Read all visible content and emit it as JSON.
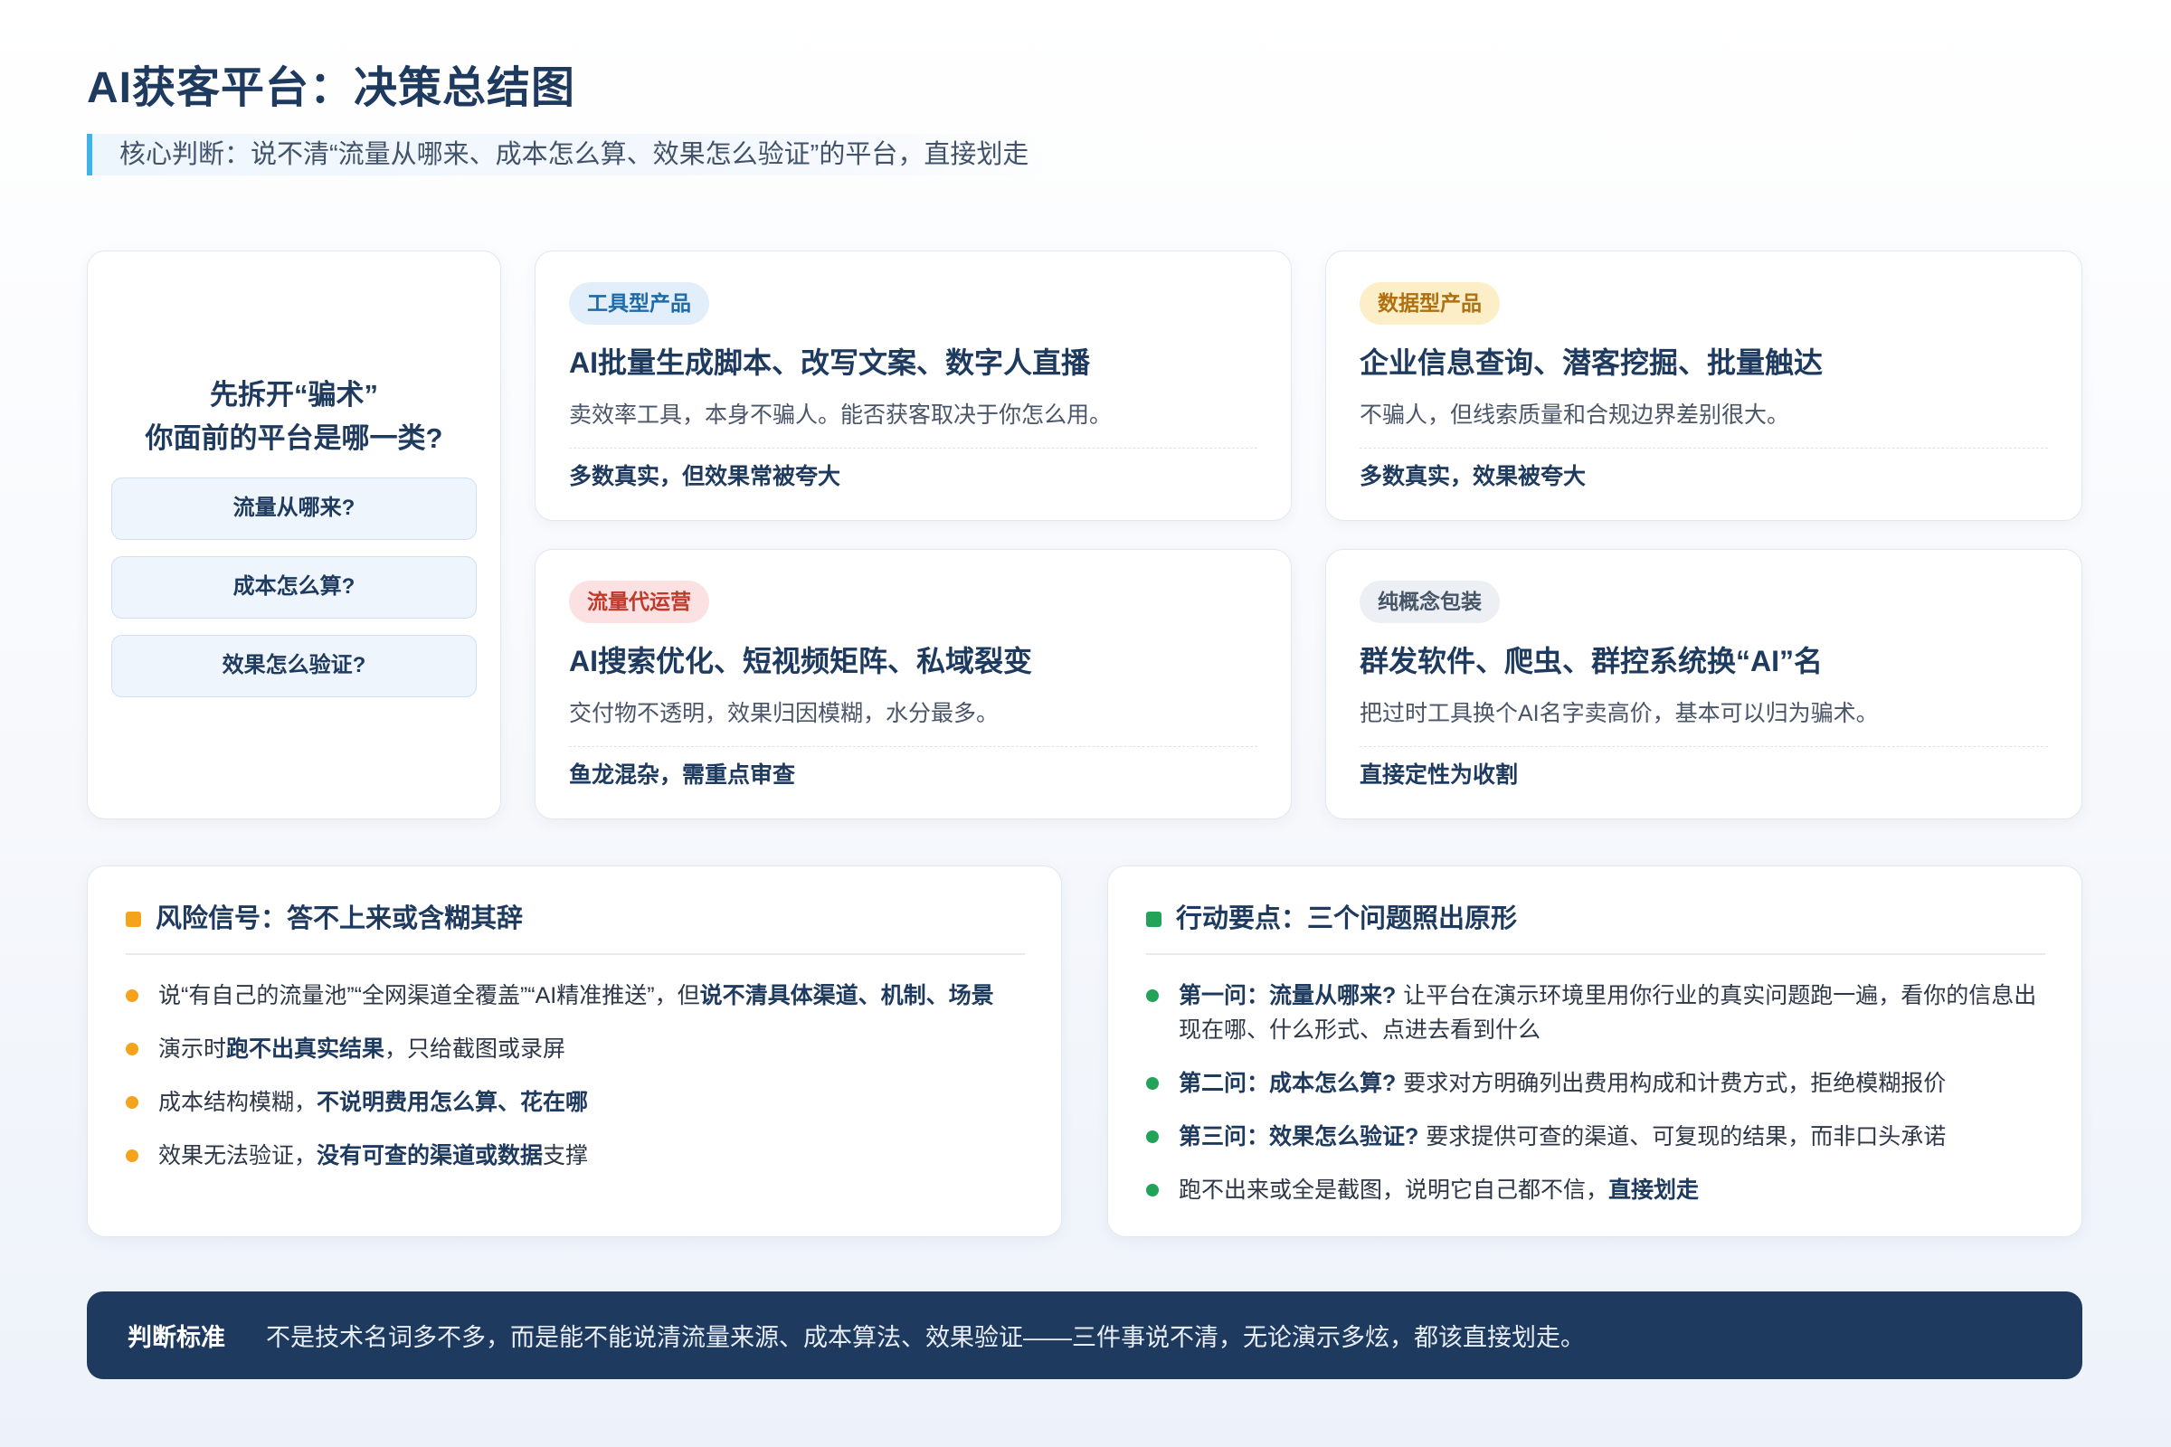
{
  "page": {
    "title": "AI获客平台：决策总结图",
    "subtitle": "核心判断：说不清“流量从哪来、成本怎么算、效果怎么验证”的平台，直接划走"
  },
  "theme": {
    "navy": "#1e3a5f",
    "accent_bar": "#3db3e8",
    "footer_bg": "#1f3a5f"
  },
  "intro": {
    "heading": [
      "先拆开“骗术”",
      "你面前的平台是哪一类?"
    ],
    "questions": [
      "流量从哪来?",
      "成本怎么算?",
      "效果怎么验证?"
    ]
  },
  "categories": [
    {
      "tag": "工具型产品",
      "tag_color": "#1f6aa8",
      "tag_bg": "#e2effb",
      "title": "AI批量生成脚本、改写文案、数字人直播",
      "desc": "卖效率工具，本身不骗人。能否获客取决于你怎么用。",
      "verdict": "多数真实，但效果常被夸大"
    },
    {
      "tag": "数据型产品",
      "tag_color": "#b06f10",
      "tag_bg": "#fcefc7",
      "title": "企业信息查询、潜客挖掘、批量触达",
      "desc": "不骗人，但线索质量和合规边界差别很大。",
      "verdict": "多数真实，效果被夸大"
    },
    {
      "tag": "流量代运营",
      "tag_color": "#c0392b",
      "tag_bg": "#fbe1e1",
      "title": "AI搜索优化、短视频矩阵、私域裂变",
      "desc": "交付物不透明，效果归因模糊，水分最多。",
      "verdict": "鱼龙混杂，需重点审查"
    },
    {
      "tag": "纯概念包装",
      "tag_color": "#475569",
      "tag_bg": "#eceff3",
      "title": "群发软件、爬虫、群控系统换“AI”名",
      "desc": "把过时工具换个AI名字卖高价，基本可以归为骗术。",
      "verdict": "直接定性为收割"
    }
  ],
  "risks": {
    "title": "风险信号：答不上来或含糊其辞",
    "marker_color": "#f5a31a",
    "items": [
      {
        "text": "说“有自己的流量池”“全网渠道全覆盖”“AI精准推送”，但",
        "bold": "说不清具体渠道、机制、场景"
      },
      {
        "text": "演示时",
        "bold": "跑不出真实结果",
        "tail": "，只给截图或录屏"
      },
      {
        "text": "成本结构模糊，",
        "bold": "不说明费用怎么算、花在哪"
      },
      {
        "text": "效果无法验证，",
        "bold": "没有可查的渠道或数据",
        "tail": "支撑"
      }
    ]
  },
  "actions": {
    "title": "行动要点：三个问题照出原形",
    "marker_color": "#22a358",
    "items": [
      {
        "bold": "第一问：流量从哪来?",
        "text": "让平台在演示环境里用你行业的真实问题跑一遍，看你的信息出现在哪、什么形式、点进去看到什么"
      },
      {
        "bold": "第二问：成本怎么算?",
        "text": "要求对方明确列出费用构成和计费方式，拒绝模糊报价"
      },
      {
        "bold": "第三问：效果怎么验证?",
        "text": "要求提供可查的渠道、可复现的结果，而非口头承诺"
      },
      {
        "text": "跑不出来或全是截图，说明它自己都不信，",
        "bold": "直接划走"
      }
    ]
  },
  "footer": {
    "label": "判断标准",
    "text": "不是技术名词多不多，而是能不能说清流量来源、成本算法、效果验证——三件事说不清，无论演示多炫，都该直接划走。"
  }
}
